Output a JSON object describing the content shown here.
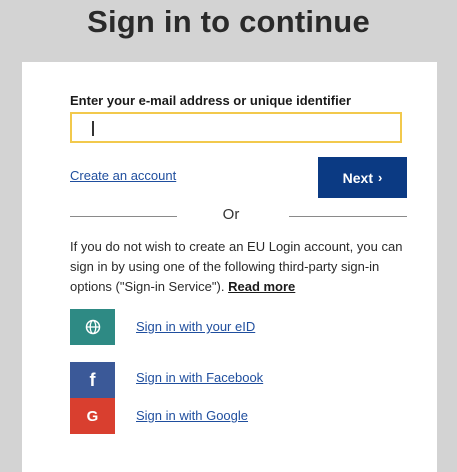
{
  "page": {
    "title": "Sign in to continue"
  },
  "login_form": {
    "email_label": "Enter your e-mail address or unique identifier",
    "email_value": "",
    "create_account_link": "Create an account",
    "next_button": "Next",
    "next_chevron": "›",
    "or_text": "Or"
  },
  "third_party": {
    "info_text": "If you do not wish to create an EU Login account, you can sign in by using one of the following third-party sign-in options (\"Sign-in Service\").",
    "read_more": "Read more",
    "providers": [
      {
        "label": "Sign in with your eID",
        "icon": "globe-icon",
        "color": "#2e8a84"
      },
      {
        "label": "Sign in with Facebook",
        "icon": "facebook-icon",
        "icon_text": "f",
        "color": "#3b5998"
      },
      {
        "label": "Sign in with Google",
        "icon": "google-icon",
        "icon_text": "G",
        "color": "#d93f2f"
      }
    ]
  },
  "colors": {
    "background": "#d3d3d3",
    "next_button": "#0b3a83",
    "input_border": "#f2c94c",
    "link": "#1f4e9e"
  }
}
